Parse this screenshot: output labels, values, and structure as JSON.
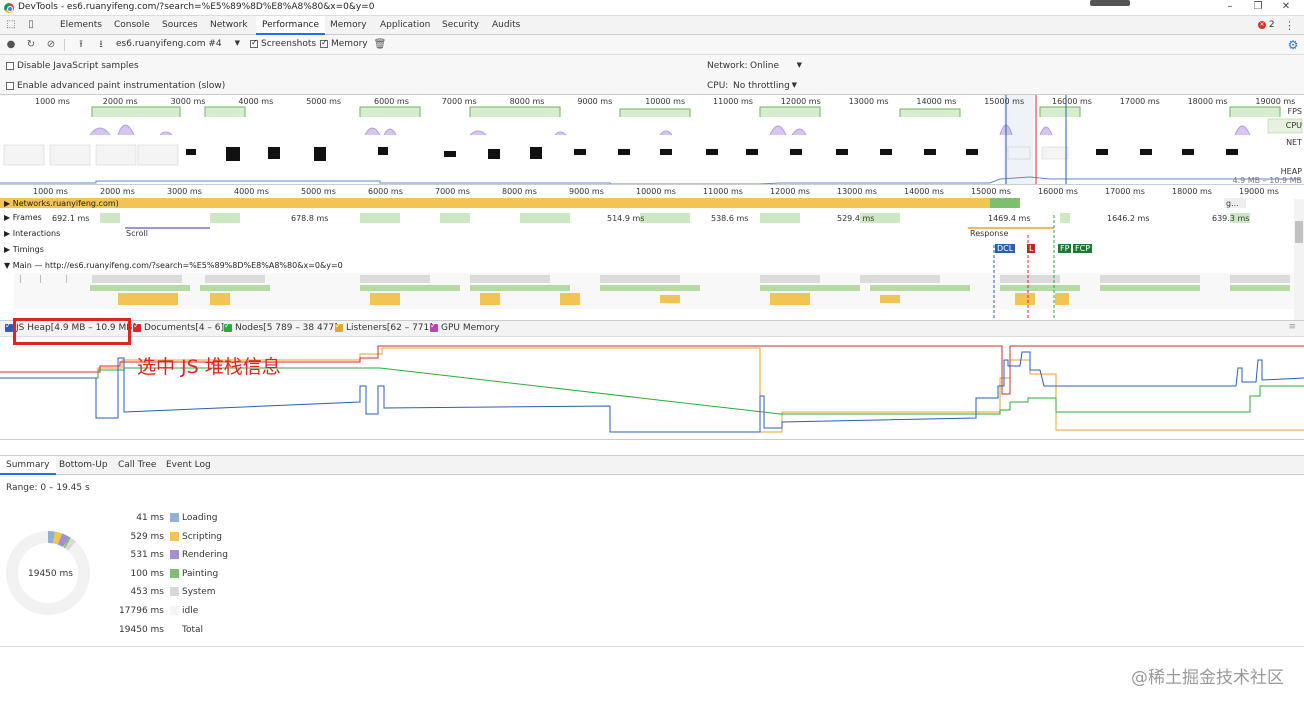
{
  "window": {
    "title": "DevTools - es6.ruanyifeng.com/?search=%E5%89%8D%E8%A8%80&x=0&y=0"
  },
  "tabs": [
    "Elements",
    "Console",
    "Sources",
    "Network",
    "Performance",
    "Memory",
    "Application",
    "Security",
    "Audits"
  ],
  "tabs_active": "Performance",
  "errors_badge": "2",
  "toolbar": {
    "profile_select": "es6.ruanyifeng.com #4",
    "screenshots_label": "Screenshots",
    "memory_label": "Memory"
  },
  "settings": {
    "disable_js_samples": "Disable JavaScript samples",
    "advanced_paint": "Enable advanced paint instrumentation (slow)",
    "network_label": "Network:",
    "network_value": "Online",
    "cpu_label": "CPU:",
    "cpu_value": "No throttling"
  },
  "overview": {
    "ticks": [
      "1000 ms",
      "2000 ms",
      "3000 ms",
      "4000 ms",
      "5000 ms",
      "6000 ms",
      "7000 ms",
      "8000 ms",
      "9000 ms",
      "10000 ms",
      "11000 ms",
      "12000 ms",
      "13000 ms",
      "14000 ms",
      "15000 ms",
      "16000 ms",
      "17000 ms",
      "18000 ms",
      "19000 ms"
    ],
    "lanes": [
      "FPS",
      "CPU",
      "NET",
      "HEAP"
    ],
    "heap_range": "4.9 MB – 10.9 MB"
  },
  "flame": {
    "ticks": [
      "1000 ms",
      "2000 ms",
      "3000 ms",
      "4000 ms",
      "5000 ms",
      "6000 ms",
      "7000 ms",
      "8000 ms",
      "9000 ms",
      "10000 ms",
      "11000 ms",
      "12000 ms",
      "13000 ms",
      "14000 ms",
      "15000 ms",
      "16000 ms",
      "17000 ms",
      "18000 ms",
      "19000 ms"
    ],
    "network_label": "Network",
    "network_host": "s.ruanyifeng.com)",
    "network_tail": "g...",
    "frames_label": "Frames",
    "frame_times": [
      "692.1 ms",
      "678.8 ms",
      "514.9 ms",
      "538.6 ms",
      "529.4 ms",
      "1469.4 ms",
      "1646.2 ms",
      "639.3 ms"
    ],
    "interactions_label": "Interactions",
    "scroll_label": "Scroll",
    "response_label": "Response",
    "timings_label": "Timings",
    "markers": [
      "DCL",
      "L",
      "FP",
      "FCP"
    ],
    "main_label": "Main — http://es6.ruanyifeng.com/?search=%E5%89%8D%E8%A8%80&x=0&y=0"
  },
  "counters": {
    "js_heap": "JS Heap[4.9 MB – 10.9 MB]",
    "documents": "Documents[4 – 6]",
    "nodes": "Nodes[5 789 – 38 477]",
    "listeners": "Listeners[62 – 771]",
    "gpu": "GPU Memory"
  },
  "annotation": "选中 JS 堆栈信息",
  "bottom_tabs": [
    "Summary",
    "Bottom-Up",
    "Call Tree",
    "Event Log"
  ],
  "summary": {
    "range": "Range: 0 – 19.45 s",
    "total_center": "19450 ms",
    "rows": [
      {
        "value": "41 ms",
        "label": "Loading",
        "color": "#8fb0d8"
      },
      {
        "value": "529 ms",
        "label": "Scripting",
        "color": "#f1c453"
      },
      {
        "value": "531 ms",
        "label": "Rendering",
        "color": "#a58ed6"
      },
      {
        "value": "100 ms",
        "label": "Painting",
        "color": "#7dbf6f"
      },
      {
        "value": "453 ms",
        "label": "System",
        "color": "#d9d9d9"
      },
      {
        "value": "17796 ms",
        "label": "idle",
        "color": "#f5f5f5"
      },
      {
        "value": "19450 ms",
        "label": "Total",
        "color": ""
      }
    ]
  },
  "watermark": "@稀土掘金技术社区",
  "colors": {
    "accent": "#1a73e8",
    "heap": "#2a5fb0",
    "documents": "#d8272d",
    "nodes": "#2eaa3c",
    "listeners": "#e9a22b",
    "annotation": "#e0251f"
  }
}
